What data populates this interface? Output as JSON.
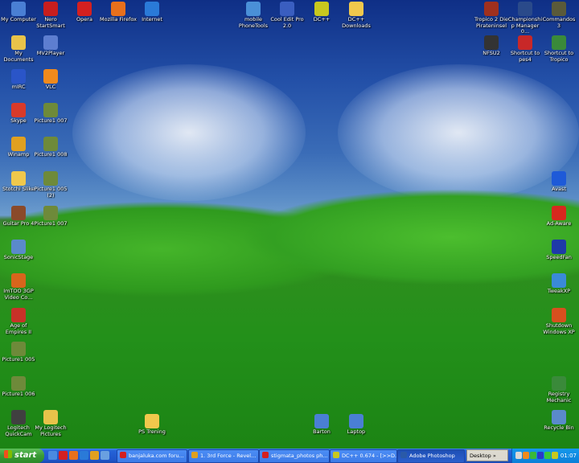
{
  "desktop": {
    "icons_left": [
      {
        "label": "My Computer",
        "icon": "computer-icon",
        "color": "#4a7fd4"
      },
      {
        "label": "My Documents",
        "icon": "documents-icon",
        "color": "#e8c34a"
      },
      {
        "label": "mIRC",
        "icon": "mirc-icon",
        "color": "#2a55c8"
      },
      {
        "label": "Skype",
        "icon": "skype-icon",
        "color": "#d83a2a"
      },
      {
        "label": "Winamp",
        "icon": "winamp-icon",
        "color": "#e0a020"
      },
      {
        "label": "Stotchi Slike",
        "icon": "folder-icon",
        "color": "#f0c84c"
      },
      {
        "label": "Guitar Pro 4",
        "icon": "guitar-icon",
        "color": "#8a4a2a"
      },
      {
        "label": "SonicStage",
        "icon": "sonicstage-icon",
        "color": "#5a8acb"
      },
      {
        "label": "ImTOO 3GP Video Co...",
        "icon": "imtoo-icon",
        "color": "#d8651c"
      },
      {
        "label": "Age of Empires II",
        "icon": "aoe-icon",
        "color": "#c83228"
      },
      {
        "label": "Picture1 005",
        "icon": "picture-icon",
        "color": "#6e8a3a"
      },
      {
        "label": "Picture1 006",
        "icon": "picture-icon",
        "color": "#6e8a3a"
      },
      {
        "label": "Logitech QuickCam",
        "icon": "webcam-icon",
        "color": "#404040"
      }
    ],
    "icons_left2": [
      {
        "label": "Nero StartSmart",
        "icon": "nero-icon",
        "color": "#c81e1e"
      },
      {
        "label": "MV2Player",
        "icon": "player-icon",
        "color": "#5d7ed0"
      },
      {
        "label": "VLC",
        "icon": "vlc-icon",
        "color": "#f08a1c"
      },
      {
        "label": "Picture1 007",
        "icon": "picture-icon",
        "color": "#6e8a3a"
      },
      {
        "label": "Picture1 008",
        "icon": "picture-icon",
        "color": "#6e8a3a"
      },
      {
        "label": "Picture1 005 (2)",
        "icon": "picture-icon",
        "color": "#6e8a3a"
      },
      {
        "label": "Picture1 007",
        "icon": "picture-icon",
        "color": "#6e8a3a"
      },
      {
        "label": "My Logitech Pictures",
        "icon": "pictures-folder-icon",
        "color": "#e8c34a"
      }
    ],
    "icons_top": [
      {
        "label": "Opera",
        "icon": "opera-icon",
        "color": "#d42020"
      },
      {
        "label": "Mozilla Firefox",
        "icon": "firefox-icon",
        "color": "#e8701c"
      },
      {
        "label": "Internet",
        "icon": "ie-icon",
        "color": "#2a7ad8"
      },
      {
        "label": "mobile PhoneTools",
        "icon": "phonetools-icon",
        "color": "#4a90d8"
      },
      {
        "label": "Cool Edit Pro 2.0",
        "icon": "cooledit-icon",
        "color": "#3a5ec0"
      },
      {
        "label": "DC++",
        "icon": "dcpp-icon",
        "color": "#c8c81e"
      },
      {
        "label": "DC++ Downloads",
        "icon": "folder-icon",
        "color": "#f0c84c"
      }
    ],
    "icons_right": [
      {
        "label": "Tropico 2 Die Pirateninsel",
        "icon": "tropico-icon",
        "color": "#a0301e"
      },
      {
        "label": "Championship Manager 0...",
        "icon": "cm-icon",
        "color": "#2a4a8a"
      },
      {
        "label": "Commandos 3",
        "icon": "commandos-icon",
        "color": "#5a5a3a"
      },
      {
        "label": "NFSU2",
        "icon": "nfsu2-icon",
        "color": "#333333"
      },
      {
        "label": "Shortcut to pes4",
        "icon": "pes4-icon",
        "color": "#c82828"
      },
      {
        "label": "Shortcut to Tropico",
        "icon": "tropico-icon",
        "color": "#3a8a3a"
      },
      {
        "label": "Avast",
        "icon": "avast-icon",
        "color": "#1e5ad8"
      },
      {
        "label": "Ad-Aware",
        "icon": "adaware-icon",
        "color": "#d8281e"
      },
      {
        "label": "SpeedFan",
        "icon": "speedfan-icon",
        "color": "#1e3aa8"
      },
      {
        "label": "TweakXP",
        "icon": "tweakxp-icon",
        "color": "#3a8ad8"
      },
      {
        "label": "Shutdown Windows XP",
        "icon": "shutdown-icon",
        "color": "#d8501e"
      },
      {
        "label": "Registry Mechanic",
        "icon": "registry-icon",
        "color": "#3a8a3a"
      },
      {
        "label": "Recycle Bin",
        "icon": "recycle-bin-icon",
        "color": "#5a8acb"
      }
    ],
    "icons_bottom": [
      {
        "label": "PS Trening",
        "icon": "folder-icon",
        "color": "#f0c84c"
      },
      {
        "label": "Barton",
        "icon": "computer-icon",
        "color": "#4a7fd4"
      },
      {
        "label": "Laptop",
        "icon": "computer-icon",
        "color": "#4a7fd4"
      }
    ]
  },
  "taskbar": {
    "start_label": "start",
    "quick_launch": [
      {
        "icon": "show-desktop-icon",
        "color": "#4a8ae0"
      },
      {
        "icon": "opera-icon",
        "color": "#d42020"
      },
      {
        "icon": "firefox-icon",
        "color": "#e8701c"
      },
      {
        "icon": "ie-icon",
        "color": "#2a7ad8"
      },
      {
        "icon": "winamp-icon",
        "color": "#e0a020"
      },
      {
        "icon": "mail-icon",
        "color": "#6aa0e0"
      }
    ],
    "tasks": [
      {
        "label": "banjaluka.com foru...",
        "icon": "opera-icon",
        "color": "#d42020",
        "active": false
      },
      {
        "label": "1. 3rd Force - Revel...",
        "icon": "winamp-icon",
        "color": "#e0a020",
        "active": false
      },
      {
        "label": "stigmata_photos ph...",
        "icon": "opera-icon",
        "color": "#d42020",
        "active": false
      },
      {
        "label": "DC++ 0.674 - [>>D...",
        "icon": "dcpp-icon",
        "color": "#c8c81e",
        "active": false
      },
      {
        "label": "Adobe Photoshop",
        "icon": "photoshop-icon",
        "color": "#2a5aa8",
        "active": true
      }
    ],
    "desktop_toolbar": "Desktop",
    "tray": [
      {
        "icon": "speaker-icon",
        "color": "#d8d8d8"
      },
      {
        "icon": "avast-tray-icon",
        "color": "#f08a1c"
      },
      {
        "icon": "network-icon",
        "color": "#3ab83a"
      },
      {
        "icon": "speedfan-tray-icon",
        "color": "#2a3ac8"
      },
      {
        "icon": "msn-icon",
        "color": "#3ac83a"
      },
      {
        "icon": "dcpp-tray-icon",
        "color": "#c8c81e"
      }
    ],
    "clock": "01:07"
  }
}
